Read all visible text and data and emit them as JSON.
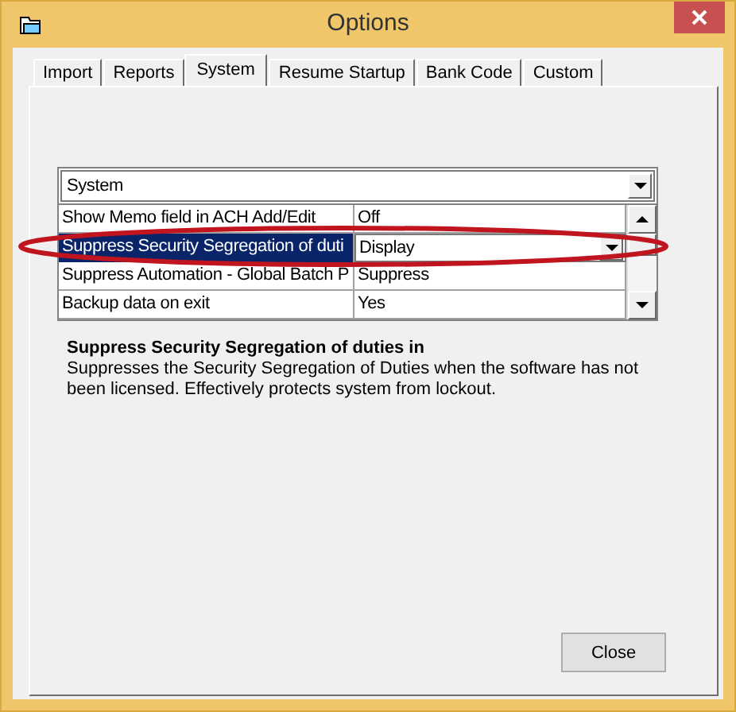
{
  "window": {
    "title": "Options"
  },
  "tabs": [
    {
      "label": "Import",
      "selected": false
    },
    {
      "label": "Reports",
      "selected": false
    },
    {
      "label": "System",
      "selected": true
    },
    {
      "label": "Resume Startup",
      "selected": false
    },
    {
      "label": "Bank Code",
      "selected": false
    },
    {
      "label": "Custom",
      "selected": false
    }
  ],
  "category": {
    "value": "System"
  },
  "settings": [
    {
      "name": "Show Memo field in ACH Add/Edit",
      "value": "Off",
      "selected": false
    },
    {
      "name": "Suppress Security Segregation of duti",
      "value": "Display",
      "selected": true
    },
    {
      "name": "Suppress Automation - Global Batch P",
      "value": "Suppress",
      "selected": false
    },
    {
      "name": "Backup data on exit",
      "value": "Yes",
      "selected": false
    }
  ],
  "description": {
    "title": "Suppress Security Segregation of duties in",
    "text": "Suppresses the Security Segregation of Duties when the software has not been licensed.  Effectively protects system from lockout."
  },
  "buttons": [
    {
      "label": "Close"
    }
  ]
}
